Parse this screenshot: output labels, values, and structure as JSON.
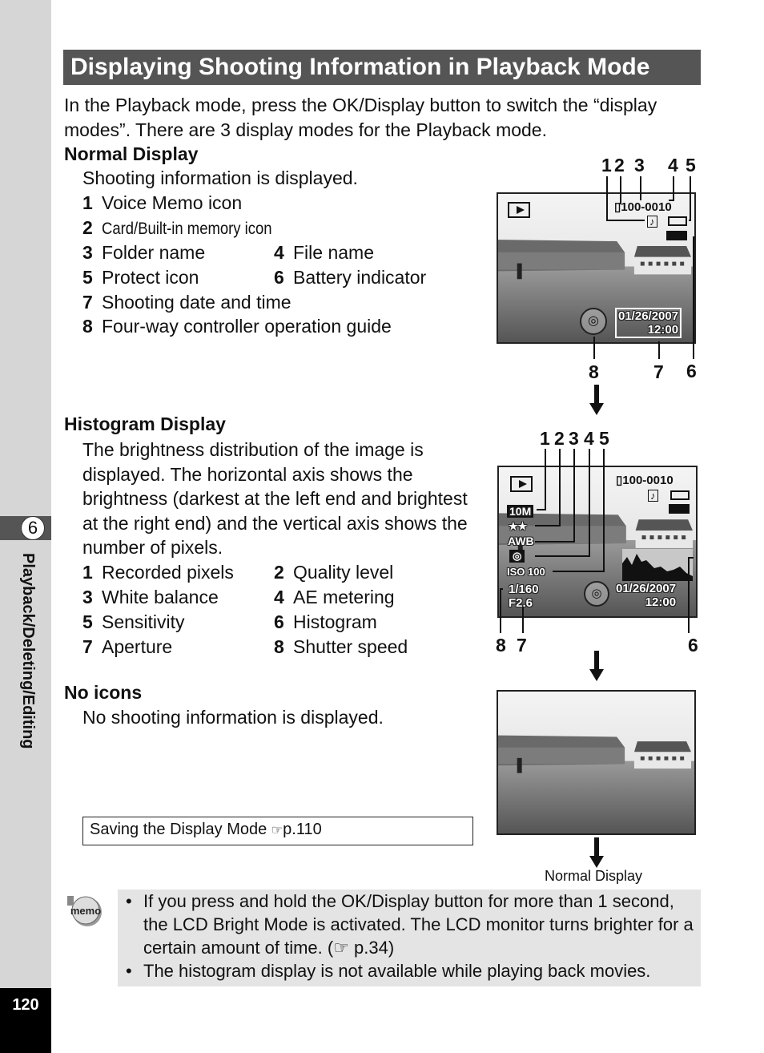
{
  "sidebar": {
    "chapter_number": "6",
    "chapter_title": "Playback/Deleting/Editing",
    "page_number": "120"
  },
  "title": "Displaying Shooting Information in Playback Mode",
  "intro": "In the Playback mode, press the OK/Display button to switch the “display modes”. There are 3 display modes for the Playback mode.",
  "normal": {
    "heading": "Normal Display",
    "desc": "Shooting information is displayed.",
    "items": [
      {
        "n": "1",
        "t": "Voice Memo icon"
      },
      {
        "n": "2",
        "t": "Card/Built-in memory icon"
      },
      {
        "n": "3",
        "t": "Folder name"
      },
      {
        "n": "4",
        "t": "File name"
      },
      {
        "n": "5",
        "t": "Protect icon"
      },
      {
        "n": "6",
        "t": "Battery indicator"
      },
      {
        "n": "7",
        "t": "Shooting date and time"
      },
      {
        "n": "8",
        "t": "Four-way controller operation guide"
      }
    ]
  },
  "histogram": {
    "heading": "Histogram Display",
    "desc": "The brightness distribution of the image is displayed. The horizontal axis shows the brightness (darkest at the left end and brightest at the right end) and the vertical axis shows the number of pixels.",
    "items": [
      {
        "n": "1",
        "t": "Recorded pixels"
      },
      {
        "n": "2",
        "t": "Quality level"
      },
      {
        "n": "3",
        "t": "White balance"
      },
      {
        "n": "4",
        "t": "AE metering"
      },
      {
        "n": "5",
        "t": "Sensitivity"
      },
      {
        "n": "6",
        "t": "Histogram"
      },
      {
        "n": "7",
        "t": "Aperture"
      },
      {
        "n": "8",
        "t": "Shutter speed"
      }
    ]
  },
  "noicons": {
    "heading": "No icons",
    "desc": "No shooting information is displayed."
  },
  "reference": {
    "text": "Saving the Display Mode ",
    "icon": "pointing-hand-icon",
    "page": "p.110"
  },
  "screen": {
    "file": "100-0010",
    "date": "01/26/2007",
    "time": "12:00",
    "pixels": "10M",
    "quality": "★★",
    "wb": "AWB",
    "iso": "ISO 100",
    "shutter": "1/160",
    "aperture": "F2.6"
  },
  "callouts": {
    "c1": "1",
    "c2": "2",
    "c3": "3",
    "c4": "4",
    "c5": "5",
    "c6": "6",
    "c7": "7",
    "c8": "8"
  },
  "caption": "Normal Display",
  "memo": {
    "icon_label": "memo",
    "bullets": [
      "If you press and hold the OK/Display button for more than 1 second, the LCD Bright Mode is activated. The LCD monitor turns brighter for a certain amount of time. (☞ p.34)",
      "The histogram display is not available while playing back movies."
    ]
  }
}
